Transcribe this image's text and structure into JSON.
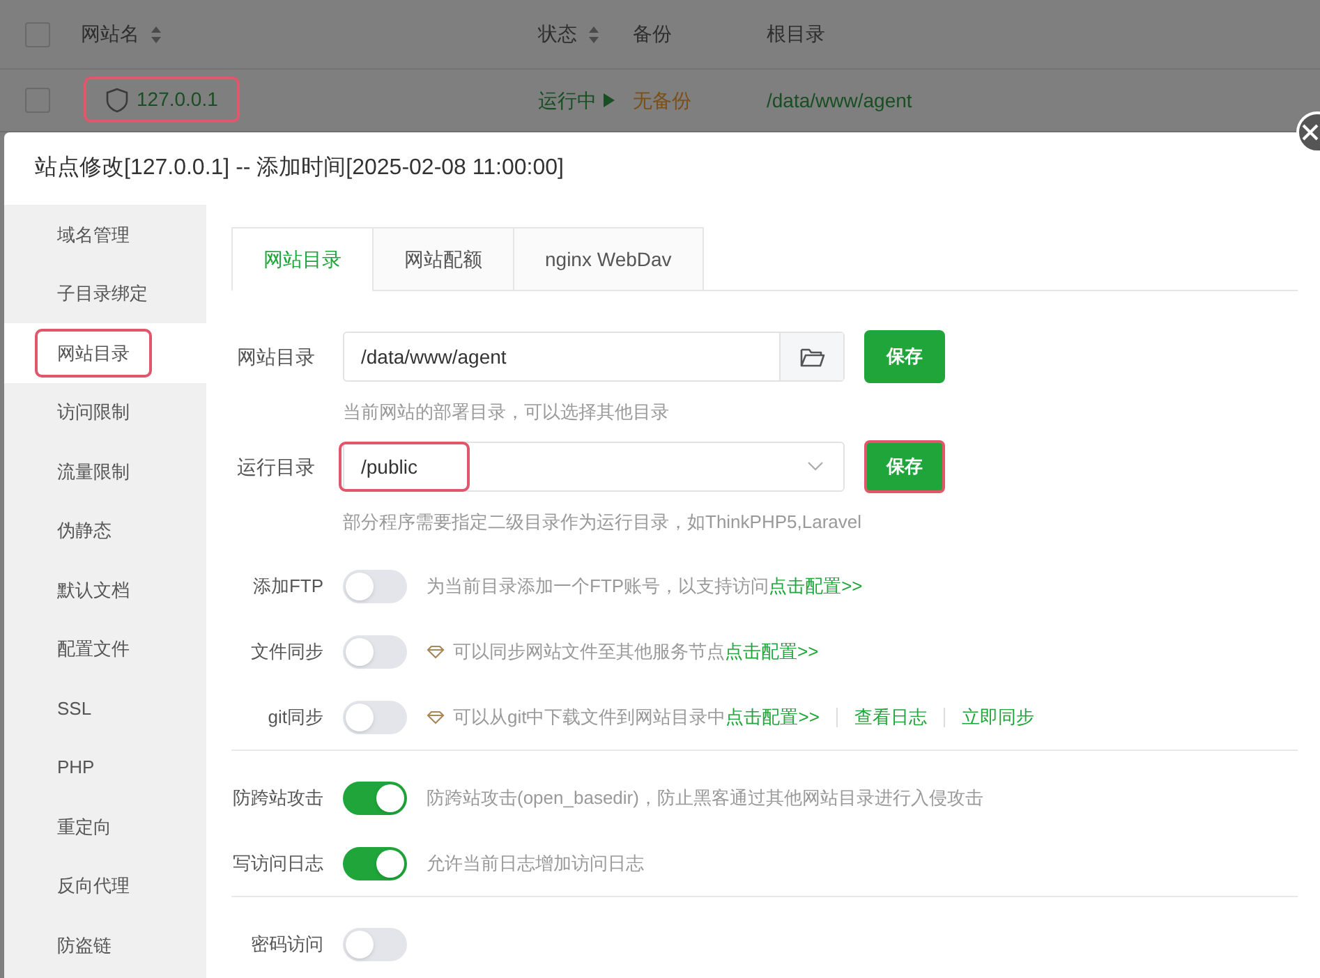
{
  "site_table": {
    "select_all_checked": false,
    "columns": [
      {
        "label": "网站名",
        "sortable": true
      },
      {
        "label": "状态",
        "sortable": true
      },
      {
        "label": "备份",
        "sortable": false
      },
      {
        "label": "根目录",
        "sortable": false
      }
    ],
    "rows": [
      {
        "checked": false,
        "name": "127.0.0.1",
        "highlighted": true,
        "status": "运行中",
        "backup": "无备份",
        "root": "/data/www/agent"
      }
    ]
  },
  "dialog": {
    "title": "站点修改[127.0.0.1] -- 添加时间[2025-02-08 11:00:00]",
    "sidebar": [
      {
        "label": "域名管理",
        "selected": false,
        "highlighted": false
      },
      {
        "label": "子目录绑定",
        "selected": false,
        "highlighted": false
      },
      {
        "label": "网站目录",
        "selected": true,
        "highlighted": true
      },
      {
        "label": "访问限制",
        "selected": false,
        "highlighted": false
      },
      {
        "label": "流量限制",
        "selected": false,
        "highlighted": false
      },
      {
        "label": "伪静态",
        "selected": false,
        "highlighted": false
      },
      {
        "label": "默认文档",
        "selected": false,
        "highlighted": false
      },
      {
        "label": "配置文件",
        "selected": false,
        "highlighted": false
      },
      {
        "label": "SSL",
        "selected": false,
        "highlighted": false
      },
      {
        "label": "PHP",
        "selected": false,
        "highlighted": false
      },
      {
        "label": "重定向",
        "selected": false,
        "highlighted": false
      },
      {
        "label": "反向代理",
        "selected": false,
        "highlighted": false
      },
      {
        "label": "防盗链",
        "selected": false,
        "highlighted": false
      }
    ],
    "tabs": [
      {
        "label": "网站目录",
        "selected": true
      },
      {
        "label": "网站配额",
        "selected": false
      },
      {
        "label": "nginx WebDav",
        "selected": false
      }
    ],
    "fields": [
      {
        "kind": "folder",
        "label": "网站目录",
        "value": "/data/www/agent",
        "value_highlighted": false,
        "button": "保存",
        "button_highlighted": false,
        "hint": "当前网站的部署目录，可以选择其他目录"
      },
      {
        "kind": "select",
        "label": "运行目录",
        "value": "/public",
        "value_highlighted": true,
        "button": "保存",
        "button_highlighted": true,
        "hint": "部分程序需要指定二级目录作为运行目录，如ThinkPHP5,Laravel"
      }
    ],
    "toggle_groups": [
      [
        {
          "label": "添加FTP",
          "on": false,
          "premium": false,
          "description": "为当前目录添加一个FTP账号，以支持访问",
          "links": [
            "点击配置>>"
          ]
        },
        {
          "label": "文件同步",
          "on": false,
          "premium": true,
          "description": "可以同步网站文件至其他服务节点",
          "links": [
            "点击配置>>"
          ]
        },
        {
          "label": "git同步",
          "on": false,
          "premium": true,
          "description": "可以从git中下载文件到网站目录中",
          "links": [
            "点击配置>>",
            "查看日志",
            "立即同步"
          ]
        }
      ],
      [
        {
          "label": "防跨站攻击",
          "on": true,
          "premium": false,
          "description": "防跨站攻击(open_basedir)，防止黑客通过其他网站目录进行入侵攻击"
        },
        {
          "label": "写访问日志",
          "on": true,
          "premium": false,
          "description": "允许当前日志增加访问日志"
        }
      ],
      [
        {
          "label": "密码访问",
          "on": false
        }
      ]
    ]
  }
}
